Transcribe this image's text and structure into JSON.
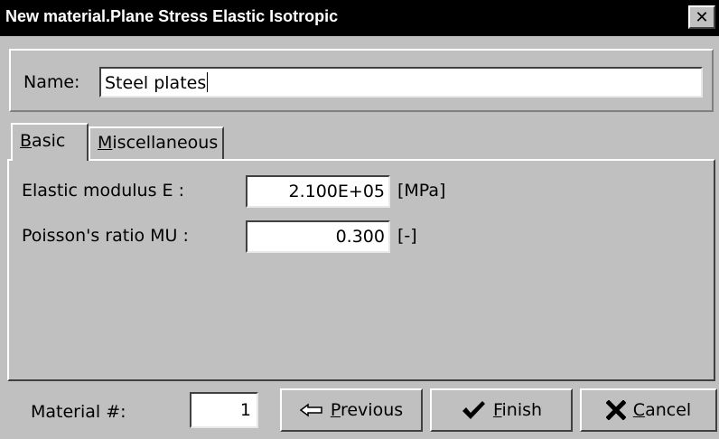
{
  "window": {
    "title": "New material.Plane Stress Elastic Isotropic",
    "close_glyph": "✕"
  },
  "name": {
    "label": "Name:",
    "value": "Steel plates"
  },
  "tabs": [
    {
      "underline": "B",
      "rest": "asic",
      "active": true
    },
    {
      "underline": "M",
      "rest": "iscellaneous",
      "active": false
    }
  ],
  "fields": [
    {
      "label": "Elastic modulus E :",
      "value": "2.100E+05",
      "unit": "[MPa]"
    },
    {
      "label": "Poisson's ratio MU :",
      "value": "0.300",
      "unit": "[-]"
    }
  ],
  "footer": {
    "material_label": "Material #:",
    "material_value": "1"
  },
  "buttons": {
    "previous": {
      "underline": "P",
      "rest": "revious",
      "icon": "arrow-left-icon"
    },
    "finish": {
      "underline": "F",
      "rest": "inish",
      "icon": "checkmark-icon"
    },
    "cancel": {
      "underline": "C",
      "rest": "ancel",
      "icon": "x-icon"
    }
  }
}
